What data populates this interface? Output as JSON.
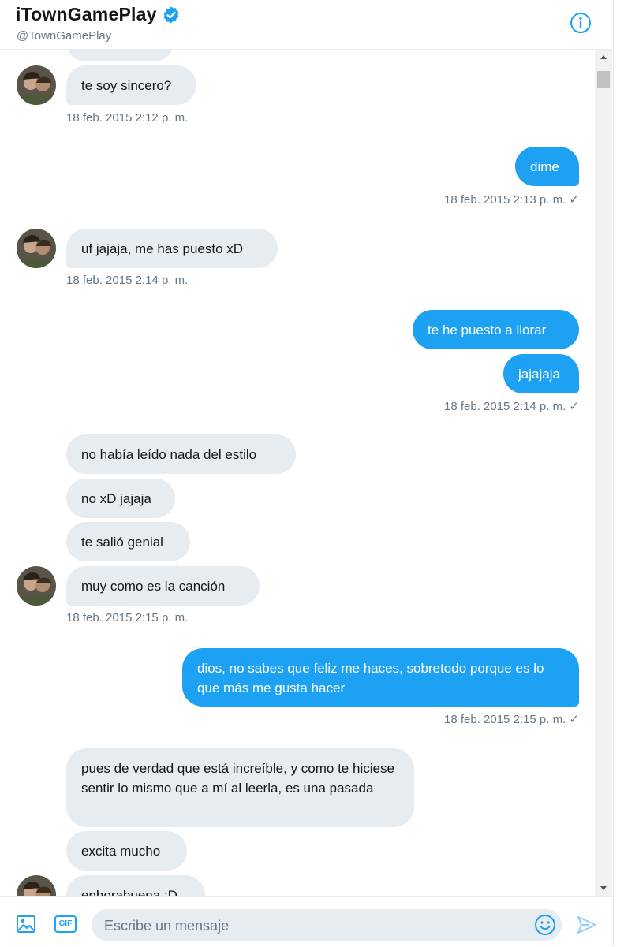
{
  "header": {
    "title": "iTownGamePlay",
    "handle": "@TownGamePlay",
    "verified_icon": "verified-badge-icon",
    "info_icon": "info-icon"
  },
  "colors": {
    "accent": "#1da1f2",
    "incoming_bubble": "#e6ecf0",
    "timestamp": "#657786"
  },
  "messages": {
    "m1": "te soy sincero?",
    "t1": "18 feb. 2015 2:12 p. m.",
    "m2": "dime",
    "t2": "18 feb. 2015 2:13 p. m. ✓",
    "m3": "uf jajaja, me has puesto xD",
    "t3": "18 feb. 2015 2:14 p. m.",
    "m4": "te he puesto a llorar",
    "m5": "jajajaja",
    "t4": "18 feb. 2015 2:14 p. m. ✓",
    "m6": "no había leído nada del estilo",
    "m7": "no xD jajaja",
    "m8": "te salió genial",
    "m9": "muy como es la canción",
    "t5": "18 feb. 2015 2:15 p. m.",
    "m10": "dios, no sabes que feliz me haces, sobretodo porque es lo que más me gusta hacer",
    "t6": "18 feb. 2015 2:15 p. m. ✓",
    "m11": "pues de verdad que está increíble, y como te hiciese sentir lo mismo que a mí al leerla, es una pasada",
    "m12": "excita mucho",
    "m13": "enhorabuena :D"
  },
  "composer": {
    "placeholder": "Escribe un mensaje",
    "media_icon": "image-icon",
    "gif_label": "GIF",
    "emoji_icon": "emoji-icon",
    "send_icon": "send-icon"
  }
}
